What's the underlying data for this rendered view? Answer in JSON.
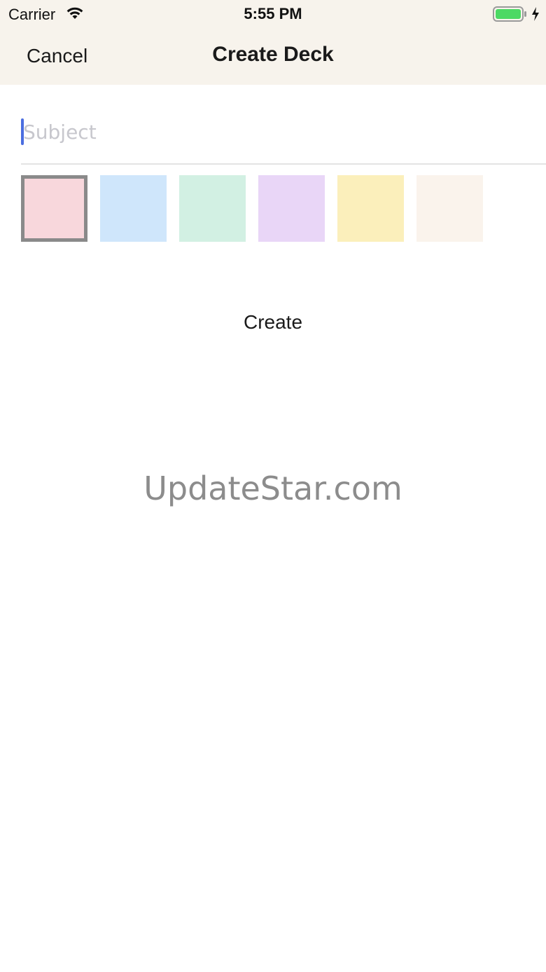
{
  "status_bar": {
    "carrier": "Carrier",
    "time": "5:55 PM",
    "battery_color": "#4cd964"
  },
  "nav": {
    "cancel_label": "Cancel",
    "title": "Create Deck"
  },
  "form": {
    "subject_placeholder": "Subject",
    "subject_value": "",
    "swatches": [
      {
        "color": "#f8d7dc",
        "selected": true
      },
      {
        "color": "#cfe6fb",
        "selected": false
      },
      {
        "color": "#d2f0e3",
        "selected": false
      },
      {
        "color": "#e9d6f7",
        "selected": false
      },
      {
        "color": "#fbefbb",
        "selected": false
      },
      {
        "color": "#faf3ec",
        "selected": false
      }
    ],
    "create_label": "Create"
  },
  "watermark": "UpdateStar.com"
}
